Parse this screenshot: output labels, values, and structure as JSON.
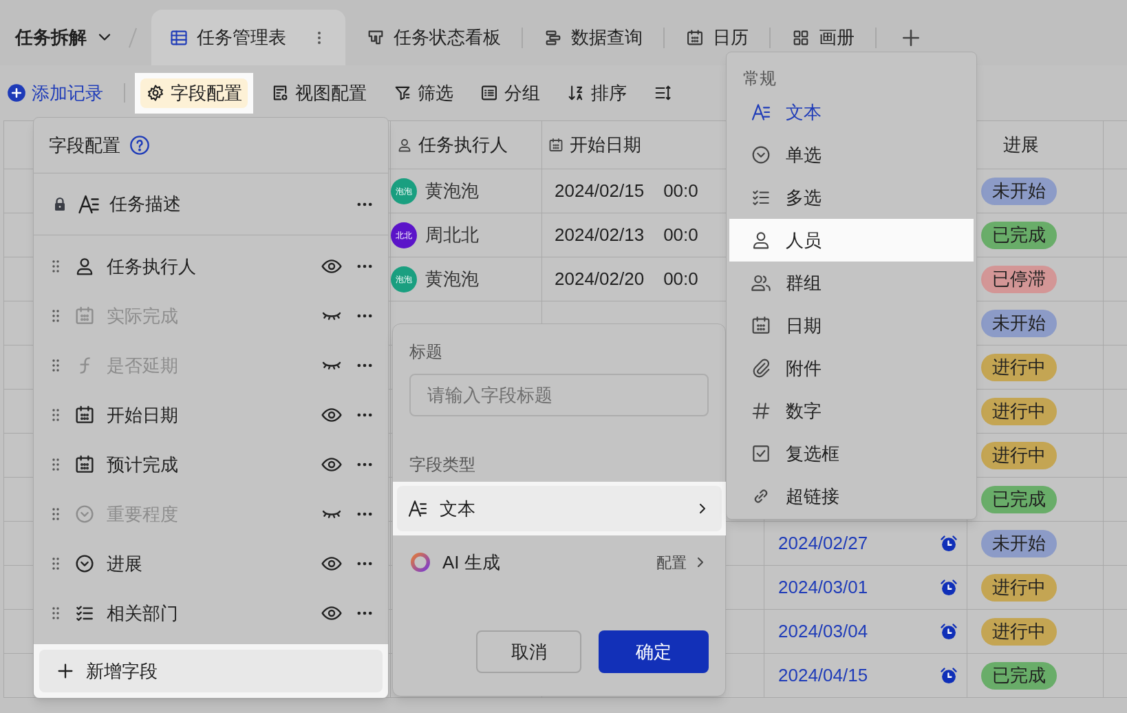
{
  "header": {
    "base_title": "任务拆解",
    "views": [
      {
        "label": "任务管理表",
        "kind": "grid",
        "selected": true
      },
      {
        "label": "任务状态看板",
        "kind": "kanban",
        "selected": false
      },
      {
        "label": "数据查询",
        "kind": "query",
        "selected": false
      },
      {
        "label": "日历",
        "kind": "calendar",
        "selected": false
      },
      {
        "label": "画册",
        "kind": "gallery",
        "selected": false
      }
    ]
  },
  "toolbar": {
    "add_record": "添加记录",
    "tools": [
      {
        "label": "字段配置",
        "kind": "gear",
        "selected": true
      },
      {
        "label": "视图配置",
        "kind": "viewcfg",
        "selected": false
      },
      {
        "label": "筛选",
        "kind": "filter",
        "selected": false
      },
      {
        "label": "分组",
        "kind": "group",
        "selected": false
      },
      {
        "label": "排序",
        "kind": "sort",
        "selected": false
      },
      {
        "kind": "rowheight",
        "selected": false
      }
    ]
  },
  "table": {
    "columns": [
      {
        "label": "任务执行人",
        "kind": "person"
      },
      {
        "label": "开始日期",
        "kind": "calendar"
      },
      {
        "label": "进展"
      }
    ],
    "rows": [
      {
        "assignee": {
          "name": "黄泡泡",
          "avatar": "泡泡",
          "color": "#1a9f80"
        },
        "start_date": "2024/02/15",
        "start_time": "00:0",
        "status": {
          "label": "未开始",
          "color": "#8c9bc7"
        }
      },
      {
        "assignee": {
          "name": "周北北",
          "avatar": "北北",
          "color": "#5b14c9"
        },
        "start_date": "2024/02/13",
        "start_time": "00:0",
        "status": {
          "label": "已完成",
          "color": "#69ad69"
        }
      },
      {
        "assignee": {
          "name": "黄泡泡",
          "avatar": "泡泡",
          "color": "#1a9f80"
        },
        "start_date": "2024/02/20",
        "start_time": "00:0",
        "status": {
          "label": "已停滞",
          "color": "#d39696"
        }
      },
      {
        "status": {
          "label": "未开始",
          "color": "#8c9bc7"
        }
      },
      {
        "status": {
          "label": "进行中",
          "color": "#c4a553"
        }
      },
      {
        "status": {
          "label": "进行中",
          "color": "#c4a553"
        }
      },
      {
        "status": {
          "label": "进行中",
          "color": "#c4a553"
        }
      },
      {
        "status": {
          "label": "已完成",
          "color": "#69ad69"
        }
      },
      {
        "end_date": "2024/02/27",
        "status": {
          "label": "未开始",
          "color": "#8c9bc7"
        }
      },
      {
        "end_date": "2024/03/01",
        "status": {
          "label": "进行中",
          "color": "#c4a553"
        }
      },
      {
        "end_date": "2024/03/04",
        "status": {
          "label": "进行中",
          "color": "#c4a553"
        }
      },
      {
        "end_date": "2024/04/15",
        "status": {
          "label": "已完成",
          "color": "#69ad69"
        }
      }
    ]
  },
  "field_panel": {
    "title": "字段配置",
    "locked_field": {
      "label": "任务描述",
      "kind": "text"
    },
    "fields": [
      {
        "label": "任务执行人",
        "kind": "person",
        "visible": true
      },
      {
        "label": "实际完成",
        "kind": "calendar",
        "visible": false
      },
      {
        "label": "是否延期",
        "kind": "formula",
        "visible": false
      },
      {
        "label": "开始日期",
        "kind": "calendar",
        "visible": true
      },
      {
        "label": "预计完成",
        "kind": "calendar",
        "visible": true
      },
      {
        "label": "重要程度",
        "kind": "single",
        "visible": false
      },
      {
        "label": "进展",
        "kind": "single",
        "visible": true
      },
      {
        "label": "相关部门",
        "kind": "multi",
        "visible": true
      }
    ],
    "add_button": "新增字段"
  },
  "field_editor": {
    "title_label": "标题",
    "title_placeholder": "请输入字段标题",
    "type_label": "字段类型",
    "type": {
      "label": "文本",
      "kind": "text"
    },
    "ai_label": "AI 生成",
    "ai_action": "配置",
    "cancel": "取消",
    "confirm": "确定"
  },
  "type_menu": {
    "heading": "常规",
    "items": [
      {
        "label": "文本",
        "kind": "text",
        "selected": true,
        "highlighted": false
      },
      {
        "label": "单选",
        "kind": "single",
        "selected": false,
        "highlighted": false
      },
      {
        "label": "多选",
        "kind": "multi",
        "selected": false,
        "highlighted": false
      },
      {
        "label": "人员",
        "kind": "person",
        "selected": false,
        "highlighted": true
      },
      {
        "label": "群组",
        "kind": "people",
        "selected": false,
        "highlighted": false
      },
      {
        "label": "日期",
        "kind": "calendar",
        "selected": false,
        "highlighted": false
      },
      {
        "label": "附件",
        "kind": "attach",
        "selected": false,
        "highlighted": false
      },
      {
        "label": "数字",
        "kind": "number",
        "selected": false,
        "highlighted": false
      },
      {
        "label": "复选框",
        "kind": "checkbox",
        "selected": false,
        "highlighted": false
      },
      {
        "label": "超链接",
        "kind": "link",
        "selected": false,
        "highlighted": false
      }
    ]
  }
}
